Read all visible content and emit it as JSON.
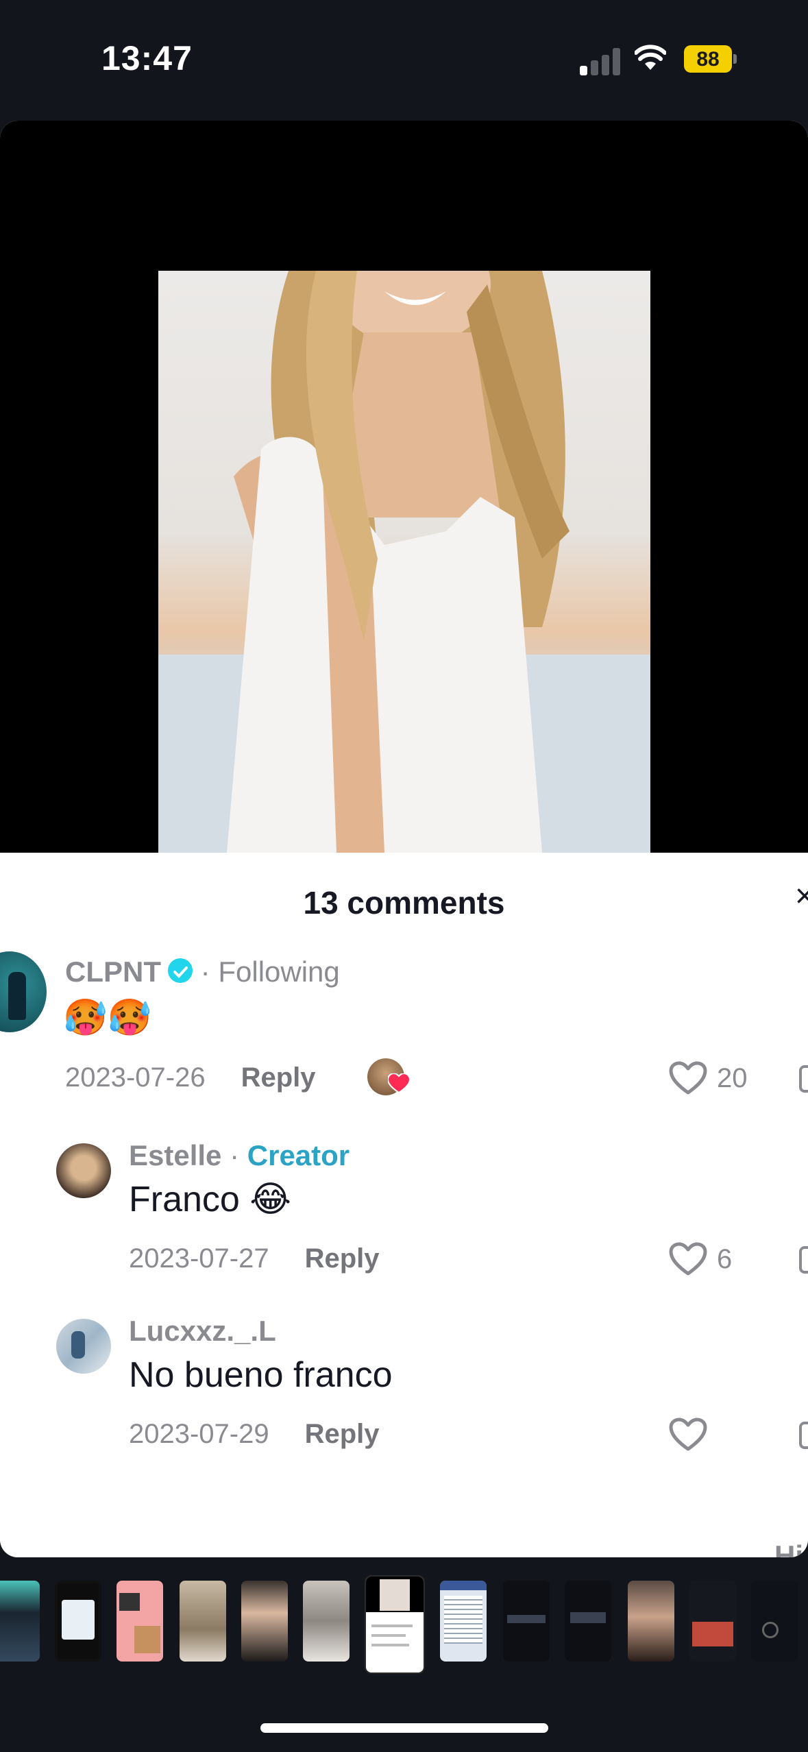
{
  "status_bar": {
    "time": "13:47",
    "battery": "88",
    "signal_icon": "cellular-signal-icon",
    "wifi_icon": "wifi-icon",
    "battery_color": "#f5d000"
  },
  "comments": {
    "title": "13 comments",
    "items": [
      {
        "username": "CLPNT",
        "separator": "·",
        "relation": "Following",
        "verified": true,
        "text": "🥵🥵",
        "date": "2023-07-26",
        "reply_label": "Reply",
        "likes": "20",
        "creator_liked": true
      },
      {
        "username": "Estelle",
        "separator": "·",
        "relation": "Creator",
        "text": "Franco 😂",
        "date": "2023-07-27",
        "reply_label": "Reply",
        "likes": "6"
      },
      {
        "username": "Lucxxz._.L",
        "text": "No bueno franco",
        "date": "2023-07-29",
        "reply_label": "Reply",
        "likes": ""
      }
    ],
    "hide_label_partial": "Hi"
  },
  "colors": {
    "accent_creator": "#2aa3c4",
    "verified_badge": "#20d5ec",
    "like_heart": "#fe2c55"
  }
}
